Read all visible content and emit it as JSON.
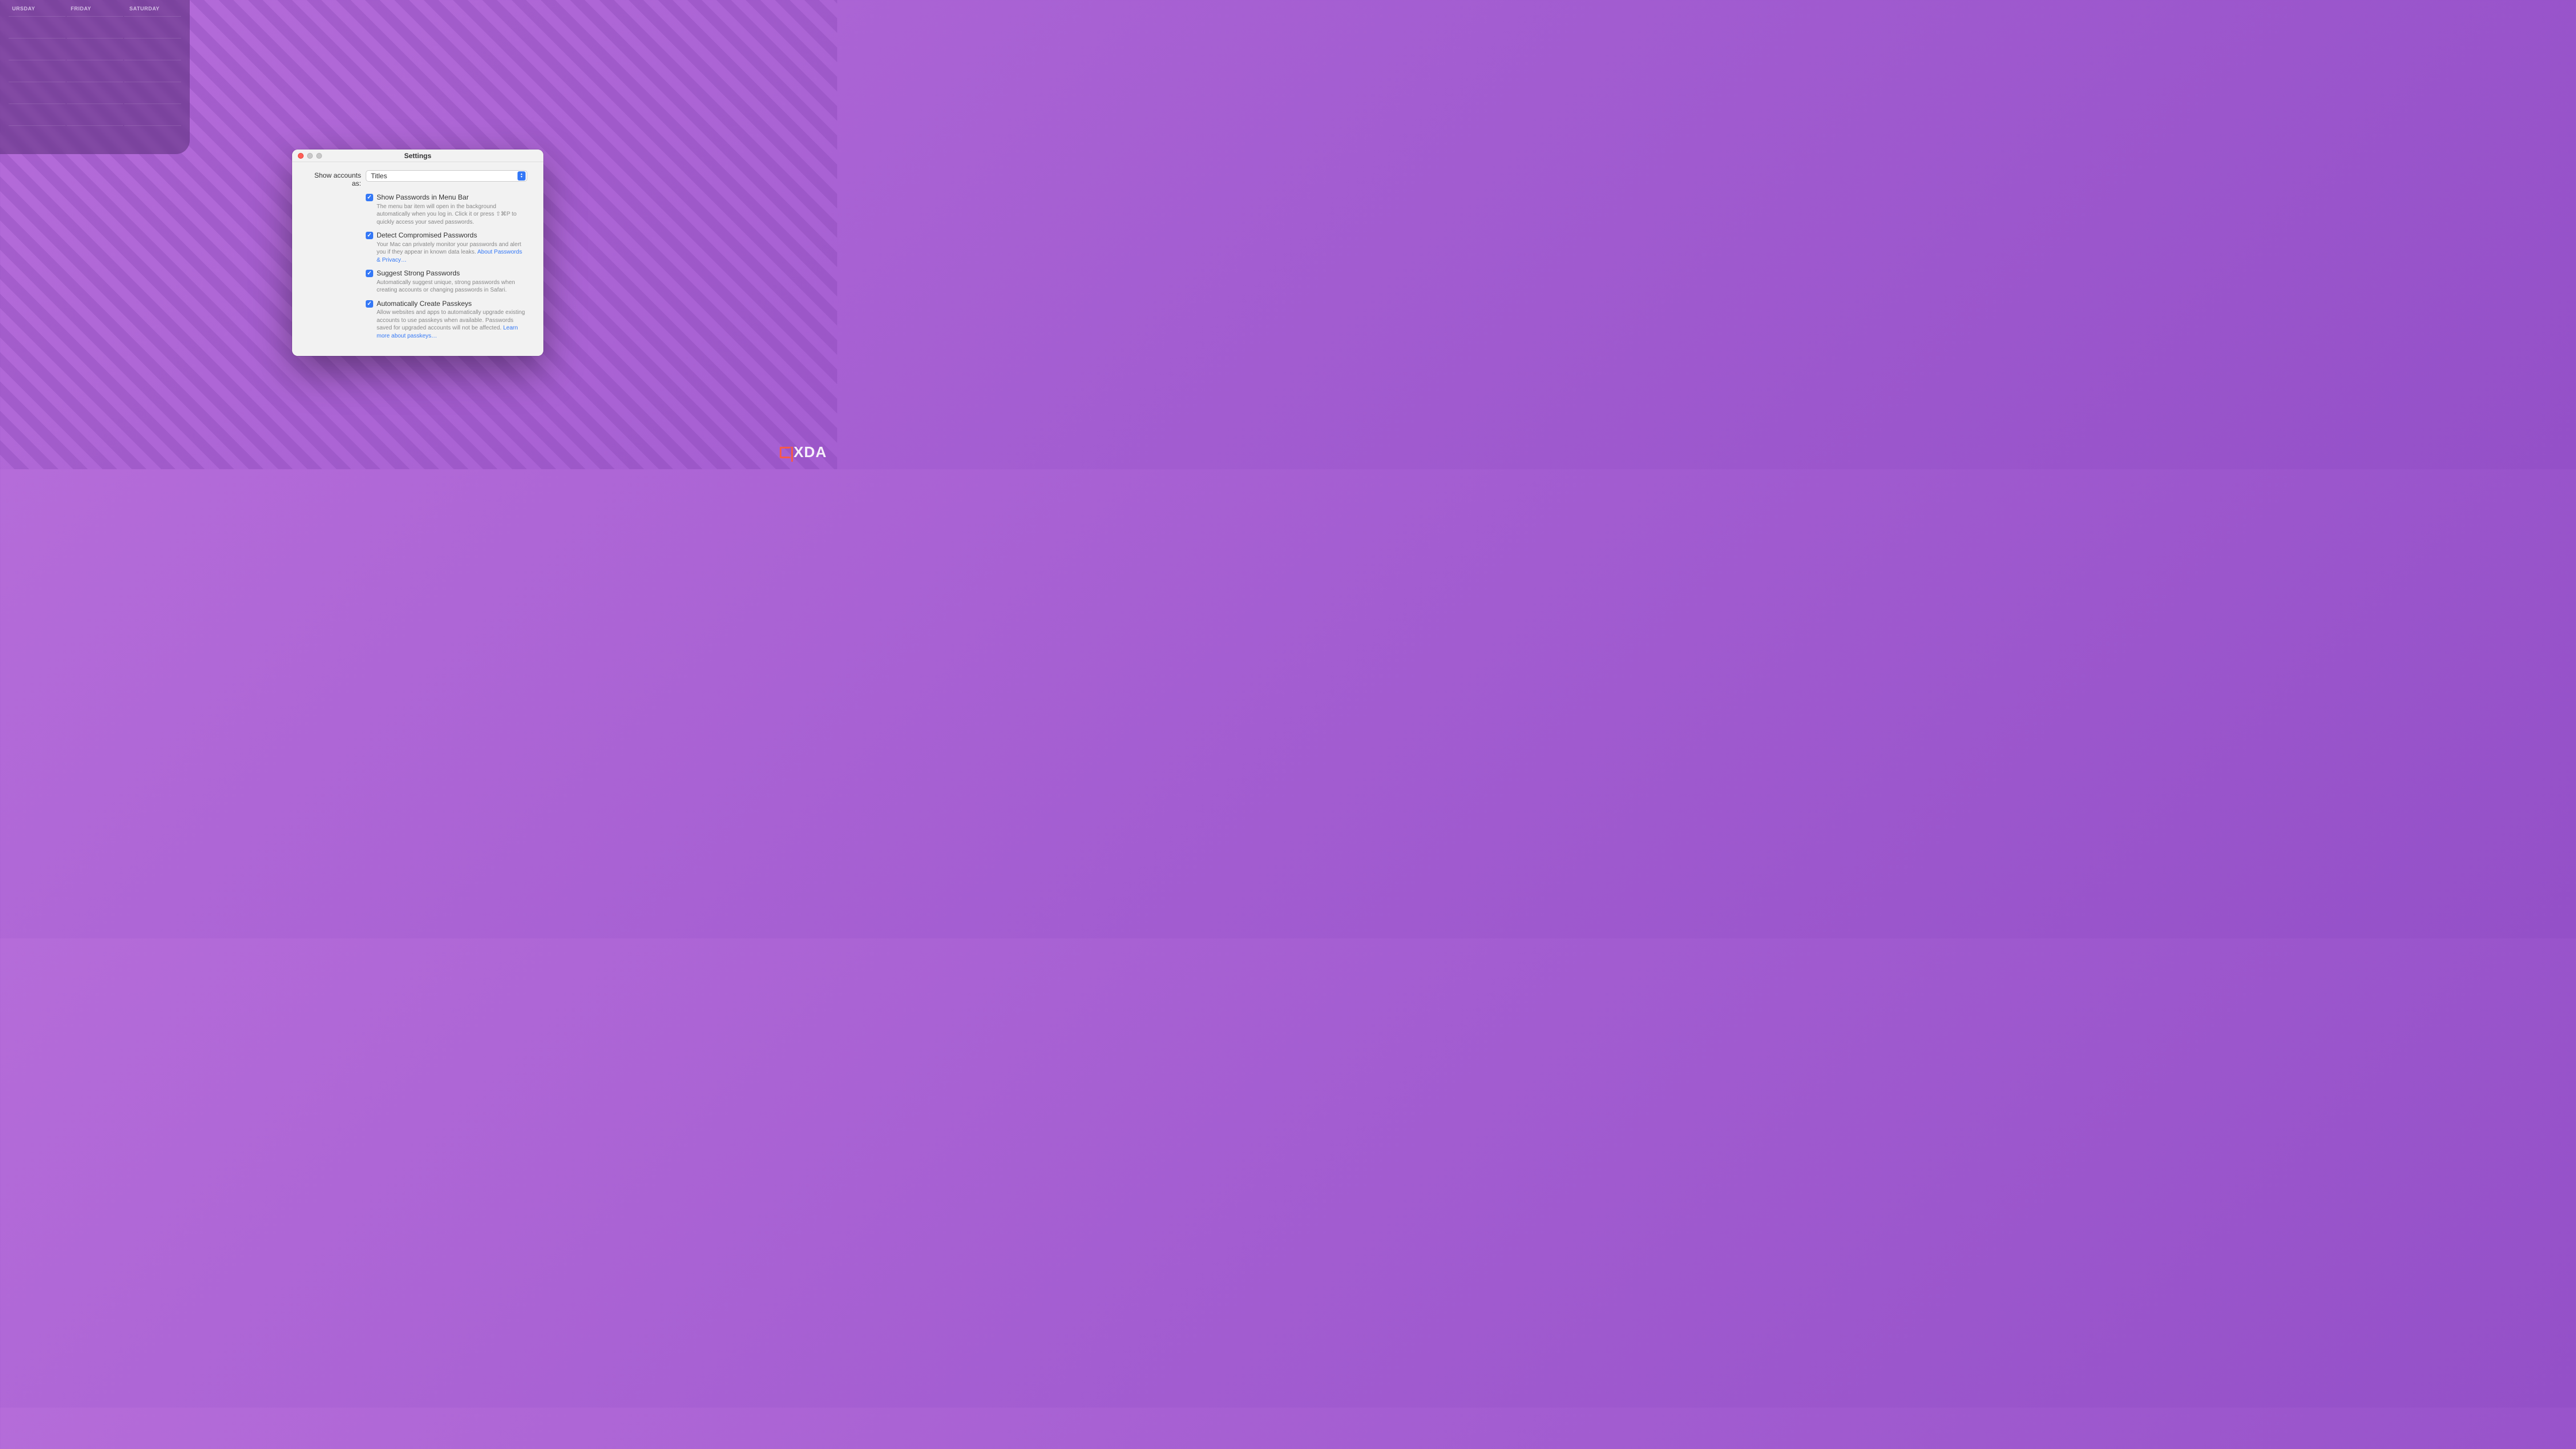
{
  "calendar": {
    "days": [
      "URSDAY",
      "FRIDAY",
      "SATURDAY"
    ]
  },
  "window": {
    "title": "Settings",
    "dropdown": {
      "label": "Show accounts as:",
      "value": "Titles"
    },
    "options": [
      {
        "title": "Show Passwords in Menu Bar",
        "desc": "The menu bar item will open in the background automatically when you log in. Click it or press ⇧⌘P to quickly access your saved passwords."
      },
      {
        "title": "Detect Compromised Passwords",
        "desc": "Your Mac can privately monitor your passwords and alert you if they appear in known data leaks. ",
        "link": "About Passwords & Privacy…"
      },
      {
        "title": "Suggest Strong Passwords",
        "desc": "Automatically suggest unique, strong passwords when creating accounts or changing passwords in Safari."
      },
      {
        "title": "Automatically Create Passkeys",
        "desc": "Allow websites and apps to automatically upgrade existing accounts to use passkeys when available. Passwords saved for upgraded accounts will not be affected. ",
        "link": "Learn more about passkeys…"
      }
    ]
  },
  "watermark": {
    "text": "XDA"
  }
}
